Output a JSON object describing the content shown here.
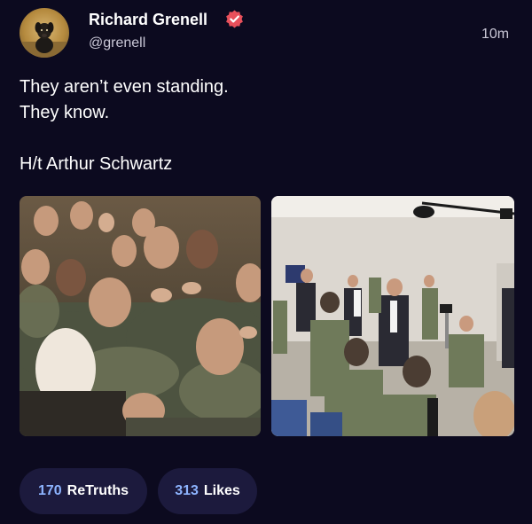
{
  "author": {
    "display_name": "Richard Grenell",
    "handle": "@grenell",
    "verified_icon": "verified-badge-icon",
    "avatar_icon": "avatar-dog-icon"
  },
  "post": {
    "timestamp": "10m",
    "lines": [
      "They aren’t even standing.",
      "They know.",
      "H/t Arthur Schwartz"
    ],
    "media": [
      {
        "icon": "photo-crowd-handshake"
      },
      {
        "icon": "photo-room-standing"
      }
    ]
  },
  "stats": {
    "retruths_count": "170",
    "retruths_label": "ReTruths",
    "likes_count": "313",
    "likes_label": "Likes"
  },
  "colors": {
    "background": "#0c0a1f",
    "pill_background": "#1c1a3d",
    "count_accent": "#8db4ff",
    "verified_badge": "#e8505b"
  }
}
